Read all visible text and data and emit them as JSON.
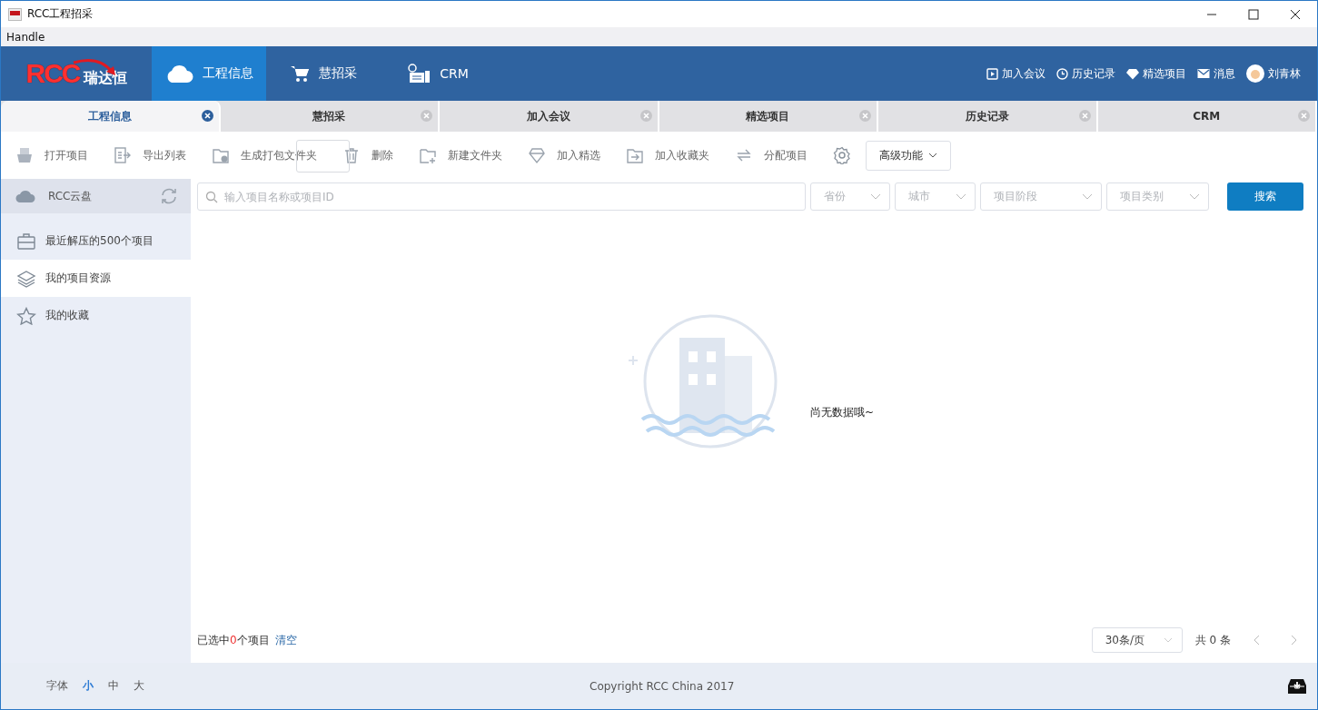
{
  "window": {
    "title": "RCC工程招采"
  },
  "menu": [
    "Handle"
  ],
  "brand": {
    "mark": "RCC",
    "name": "瑞达恒"
  },
  "nav": [
    {
      "label": "工程信息",
      "kind": "cloud",
      "selected": true
    },
    {
      "label": "慧招采",
      "kind": "cart",
      "selected": false
    },
    {
      "label": "CRM",
      "kind": "desk",
      "selected": false
    }
  ],
  "nav_links": [
    {
      "label": "加入会议",
      "kind": "play"
    },
    {
      "label": "历史记录",
      "kind": "clock"
    },
    {
      "label": "精选项目",
      "kind": "diamond"
    },
    {
      "label": "消息",
      "kind": "mail"
    }
  ],
  "user": {
    "name": "刘青林"
  },
  "tabs": [
    {
      "label": "工程信息",
      "selected": true
    },
    {
      "label": "慧招采",
      "selected": false
    },
    {
      "label": "加入会议",
      "selected": false
    },
    {
      "label": "精选项目",
      "selected": false
    },
    {
      "label": "历史记录",
      "selected": false
    },
    {
      "label": "CRM",
      "selected": false
    }
  ],
  "toolbar": [
    {
      "label": "打开项目",
      "kind": "open"
    },
    {
      "label": "导出列表",
      "kind": "export"
    },
    {
      "label": "生成打包文件夹",
      "kind": "pack"
    },
    {
      "label": "删除",
      "kind": "trash"
    },
    {
      "label": "新建文件夹",
      "kind": "newfolder"
    },
    {
      "label": "加入精选",
      "kind": "diamond"
    },
    {
      "label": "加入收藏夹",
      "kind": "fav"
    },
    {
      "label": "分配项目",
      "kind": "swap"
    }
  ],
  "advanced_button": "高级功能",
  "sidebar": {
    "header": "RCC云盘",
    "items": [
      {
        "label": "最近解压的500个项目",
        "kind": "case",
        "selected": false
      },
      {
        "label": "我的项目资源",
        "kind": "layers",
        "selected": true
      },
      {
        "label": "我的收藏",
        "kind": "star",
        "selected": false
      }
    ]
  },
  "search": {
    "placeholder": "输入项目名称或项目ID",
    "filters": [
      "省份",
      "城市",
      "项目阶段",
      "项目类别"
    ],
    "button": "搜索"
  },
  "empty_text": "尚无数据哦~",
  "selection": {
    "prefix": "已选中",
    "count": "0",
    "suffix": "个项目",
    "clear": "清空"
  },
  "pagination": {
    "page_size": "30条/页",
    "total": "共 0 条"
  },
  "font_size": {
    "label": "字体",
    "options": [
      {
        "label": "小",
        "selected": true
      },
      {
        "label": "中",
        "selected": false
      },
      {
        "label": "大",
        "selected": false
      }
    ]
  },
  "copyright": "Copyright RCC China 2017"
}
